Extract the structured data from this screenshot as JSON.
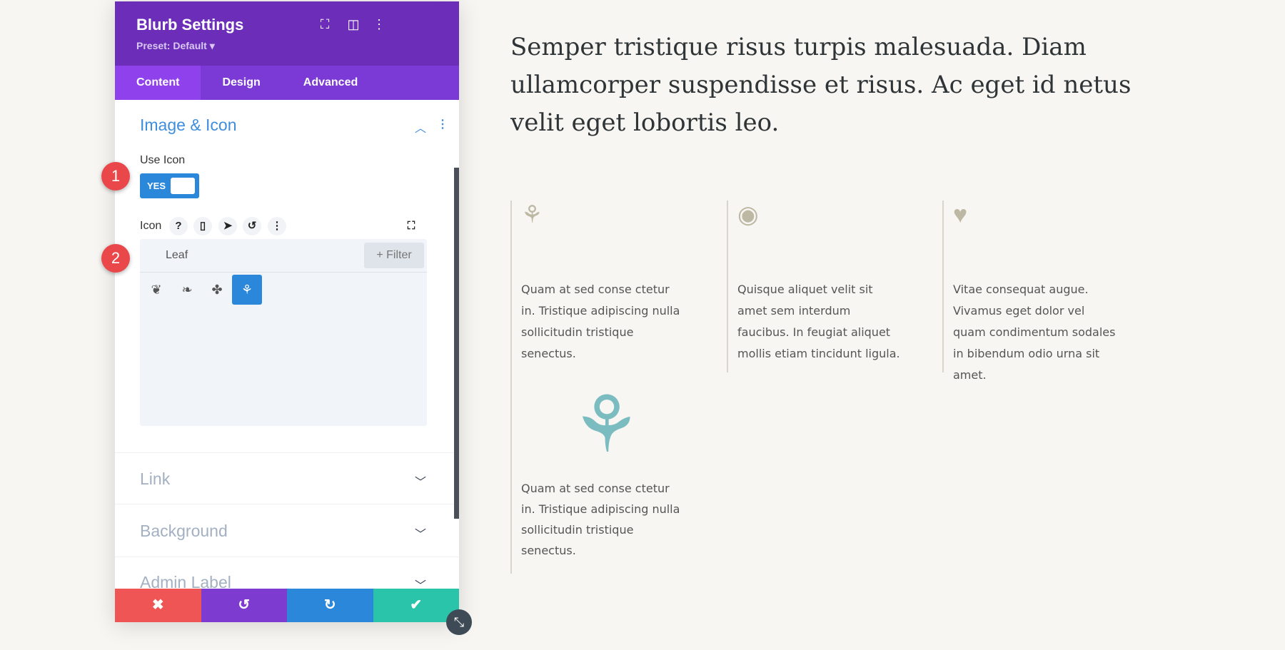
{
  "panel": {
    "title": "Blurb Settings",
    "preset": "Preset: Default ▾",
    "tabs": [
      {
        "label": "Content",
        "active": true
      },
      {
        "label": "Design",
        "active": false
      },
      {
        "label": "Advanced",
        "active": false
      }
    ],
    "section_open": "Image & Icon",
    "use_icon_label": "Use Icon",
    "toggle_label": "YES",
    "icon_label": "Icon",
    "search_value": "Leaf",
    "filter_label": "+ Filter",
    "icons": [
      "leaf-filled-icon",
      "leaf-outline-icon",
      "maple-leaf-icon",
      "branch-leaf-icon"
    ],
    "selected_icon": "branch-leaf-icon",
    "collapsed_sections": [
      "Link",
      "Background",
      "Admin Label"
    ],
    "colors": {
      "header": "#6c2eb9",
      "accent": "#2b87da",
      "cancel": "#ef5555",
      "undo": "#7e3bd0",
      "redo": "#2b87da",
      "save": "#29c4a9"
    }
  },
  "badges": [
    "1",
    "2"
  ],
  "page": {
    "heading": "Semper tristique risus turpis malesuada. Diam ullamcorper suspendisse et risus. Ac eget id netus velit eget lobortis leo.",
    "blurbs": [
      {
        "icon": "leaf-icon",
        "text": "Quam at sed conse ctetur in. Tristique adipiscing nulla sollicitudin tristique senectus."
      },
      {
        "icon": "eye-icon",
        "text": "Quisque aliquet velit sit amet sem interdum faucibus. In feugiat aliquet mollis etiam tincidunt ligula."
      },
      {
        "icon": "heart-hand-icon",
        "text": "Vitae consequat augue. Vivamus eget dolor vel quam condimentum sodales in bibendum odio urna sit amet."
      }
    ],
    "preview_blurb": {
      "icon": "leaf-icon",
      "color": "#7bbcc0",
      "text": "Quam at sed conse ctetur in. Tristique adipiscing nulla sollicitudin tristique senectus."
    }
  }
}
